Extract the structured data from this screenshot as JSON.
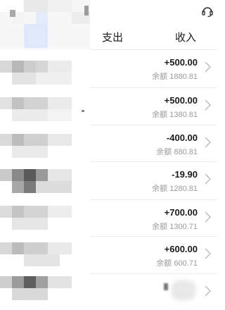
{
  "header": {
    "tab_expense": "支出",
    "tab_income": "收入",
    "support_icon": "headset-icon"
  },
  "balance_prefix": "余额",
  "rows": [
    {
      "amount": "+500.00",
      "balance": "1880.81"
    },
    {
      "amount": "+500.00",
      "balance": "1380.81"
    },
    {
      "amount": "-400.00",
      "balance": "880.81"
    },
    {
      "amount": "-19.90",
      "balance": "1280.81"
    },
    {
      "amount": "+700.00",
      "balance": "1300.71"
    },
    {
      "amount": "+600.00",
      "balance": "600.71"
    }
  ],
  "colors": {
    "text": "#1a1a1a",
    "muted": "#9a9a9a",
    "divider": "#ececec"
  }
}
